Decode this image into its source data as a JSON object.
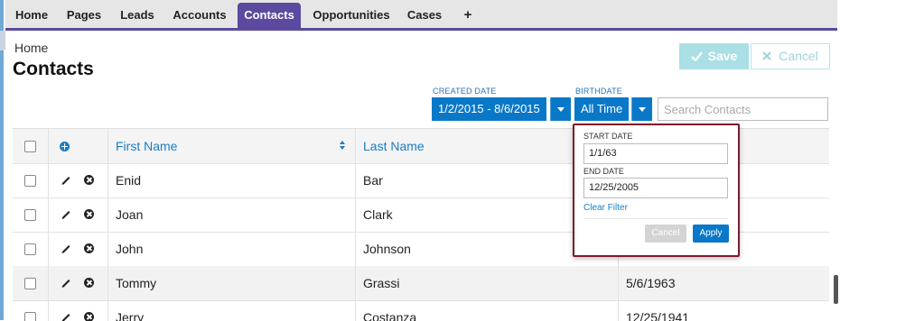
{
  "nav": {
    "tabs": [
      {
        "label": "Home"
      },
      {
        "label": "Pages"
      },
      {
        "label": "Leads"
      },
      {
        "label": "Accounts"
      },
      {
        "label": "Contacts",
        "active": true
      },
      {
        "label": "Opportunities"
      },
      {
        "label": "Cases"
      }
    ],
    "add_label": "+"
  },
  "header": {
    "breadcrumb": "Home",
    "title": "Contacts",
    "save_label": "Save",
    "cancel_label": "Cancel"
  },
  "filters": {
    "created_date": {
      "label": "CREATED DATE",
      "value": "1/2/2015 - 8/6/2015"
    },
    "birthdate": {
      "label": "BIRTHDATE",
      "value": "All Time"
    },
    "search_placeholder": "Search Contacts"
  },
  "popover": {
    "start_label": "START DATE",
    "start_value": "1/1/63",
    "end_label": "END DATE",
    "end_value": "12/25/2005",
    "clear_label": "Clear Filter",
    "cancel_label": "Cancel",
    "apply_label": "Apply"
  },
  "table": {
    "columns": {
      "first_name": "First Name",
      "last_name": "Last Name"
    },
    "rows": [
      {
        "first": "Enid",
        "last": "Bar",
        "birthdate": ""
      },
      {
        "first": "Joan",
        "last": "Clark",
        "birthdate": ""
      },
      {
        "first": "John",
        "last": "Johnson",
        "birthdate": ""
      },
      {
        "first": "Tommy",
        "last": "Grassi",
        "birthdate": "5/6/1963"
      },
      {
        "first": "Jerry",
        "last": "Costanza",
        "birthdate": "12/25/1941"
      }
    ]
  },
  "colors": {
    "nav_active": "#5b4a9f",
    "primary": "#0a78c8",
    "popover_border": "#7d1a2a"
  },
  "icons": [
    "plus-circle-icon",
    "sort-icon",
    "pencil-icon",
    "delete-circle-icon",
    "check-icon",
    "close-icon",
    "caret-down-icon"
  ]
}
